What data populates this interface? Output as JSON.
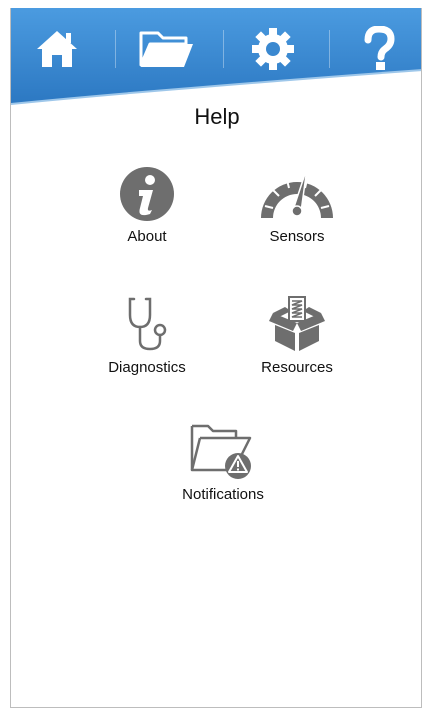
{
  "nav": {
    "items": [
      {
        "name": "home",
        "icon": "home-icon"
      },
      {
        "name": "files",
        "icon": "folder-icon"
      },
      {
        "name": "settings",
        "icon": "gear-icon"
      },
      {
        "name": "help",
        "icon": "question-icon"
      }
    ]
  },
  "page": {
    "title": "Help"
  },
  "tiles": {
    "about": {
      "label": "About",
      "icon": "info-icon"
    },
    "sensors": {
      "label": "Sensors",
      "icon": "gauge-icon"
    },
    "diagnostics": {
      "label": "Diagnostics",
      "icon": "stethoscope-icon"
    },
    "resources": {
      "label": "Resources",
      "icon": "box-icon"
    },
    "notifications": {
      "label": "Notifications",
      "icon": "folder-alert-icon"
    }
  },
  "colors": {
    "brand_blue": "#2f7fc8",
    "icon_gray": "#6e6e6e"
  }
}
